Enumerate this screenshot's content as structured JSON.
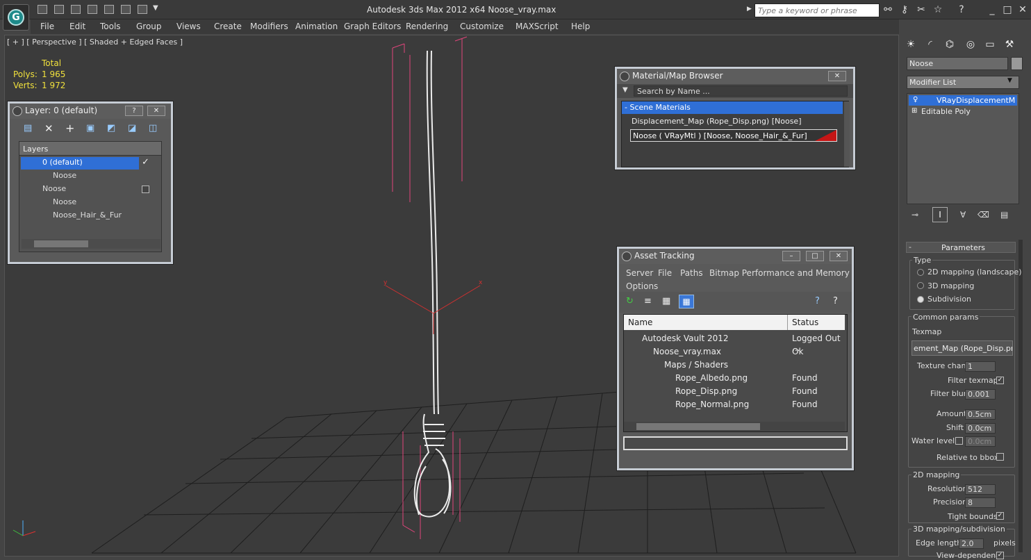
{
  "app": {
    "title": "Autodesk 3ds Max  2012 x64       Noose_vray.max",
    "search_placeholder": "Type a keyword or phrase"
  },
  "menu": [
    "File",
    "Edit",
    "Tools",
    "Group",
    "Views",
    "Create",
    "Modifiers",
    "Animation",
    "Graph Editors",
    "Rendering",
    "Customize",
    "MAXScript",
    "Help"
  ],
  "viewport": {
    "label": "[ + ] [ Perspective ] [ Shaded + Edged Faces ]",
    "stats": {
      "header": "Total",
      "polys_label": "Polys:",
      "polys": "1 965",
      "verts_label": "Verts:",
      "verts": "1 972"
    }
  },
  "layer_window": {
    "title": "Layer: 0 (default)",
    "help": "?",
    "column": "Layers",
    "rows": [
      {
        "label": "0 (default)",
        "indent": 0,
        "selected": true
      },
      {
        "label": "Noose",
        "indent": 1
      },
      {
        "label": "Noose",
        "indent": 0
      },
      {
        "label": "Noose",
        "indent": 1
      },
      {
        "label": "Noose_Hair_&_Fur",
        "indent": 1
      }
    ],
    "check_mark": "✓"
  },
  "material_browser": {
    "title": "Material/Map Browser",
    "search": "Search by Name ...",
    "section": "- Scene Materials",
    "items": [
      "Displacement_Map (Rope_Disp.png) [Noose]",
      "Noose  ( VRayMtl ) [Noose, Noose_Hair_&_Fur]"
    ]
  },
  "asset_tracking": {
    "title": "Asset Tracking",
    "menu": [
      "Server",
      "File",
      "Paths",
      "Bitmap Performance and Memory",
      "Options"
    ],
    "columns": [
      "Name",
      "Status"
    ],
    "rows": [
      {
        "name": "Autodesk Vault 2012",
        "status": "Logged Out ..."
      },
      {
        "name": "Noose_vray.max",
        "status": "Ok"
      },
      {
        "name": "Maps / Shaders",
        "status": ""
      },
      {
        "name": "Rope_Albedo.png",
        "status": "Found"
      },
      {
        "name": "Rope_Disp.png",
        "status": "Found"
      },
      {
        "name": "Rope_Normal.png",
        "status": "Found"
      }
    ]
  },
  "command_panel": {
    "object_name": "Noose",
    "modifier_list": "Modifier List",
    "stack": [
      "VRayDisplacementM",
      "Editable Poly"
    ],
    "rollout": "Parameters",
    "type_group": "Type",
    "types": [
      "2D mapping (landscape)",
      "3D mapping",
      "Subdivision"
    ],
    "common_group": "Common params",
    "texmap_label": "Texmap",
    "texmap_value": "ement_Map (Rope_Disp.png)",
    "texture_chan_label": "Texture chan",
    "texture_chan": "1",
    "filter_texmap_label": "Filter texmap",
    "filter_blur_label": "Filter blur",
    "filter_blur": "0.001",
    "amount_label": "Amount",
    "amount": "0.5cm",
    "shift_label": "Shift",
    "shift": "0.0cm",
    "water_label": "Water level",
    "water": "0.0cm",
    "relative_label": "Relative to bbox",
    "map2d_group": "2D mapping",
    "resolution_label": "Resolution",
    "resolution": "512",
    "precision_label": "Precision",
    "precision": "8",
    "tight_label": "Tight bounds",
    "map3d_group": "3D mapping/subdivision",
    "edge_label": "Edge length",
    "edge": "2.0",
    "edge_unit": "pixels",
    "view_dep_label": "View-dependent"
  },
  "accent": {
    "selection": "#2f6fd6",
    "bbox": "#e0457b",
    "gizmo": "#e03030"
  }
}
